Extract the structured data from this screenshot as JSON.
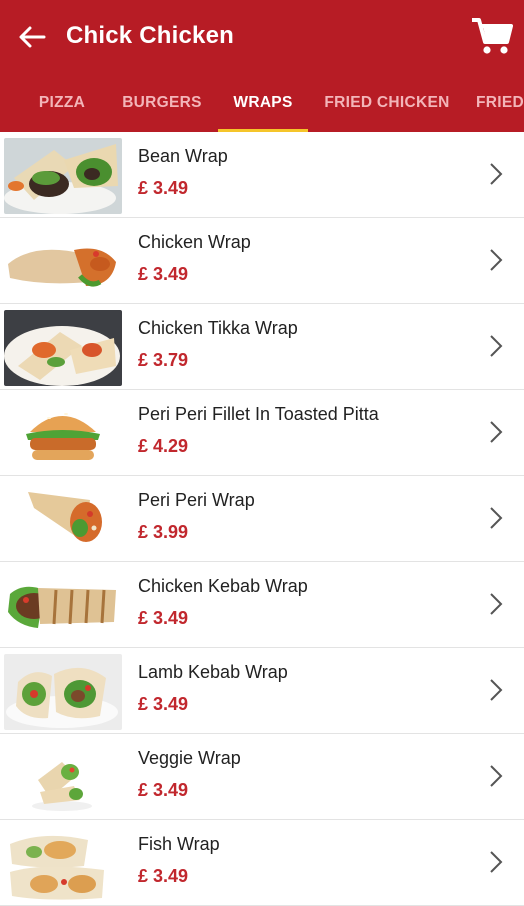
{
  "header": {
    "title": "Chick Chicken",
    "back_icon": "arrow-left-icon",
    "cart_icon": "shopping-cart-icon"
  },
  "tabs": [
    {
      "label": "PIZZA"
    },
    {
      "label": "BURGERS"
    },
    {
      "label": "WRAPS",
      "active": true
    },
    {
      "label": "FRIED CHICKEN"
    },
    {
      "label": "FRIED"
    }
  ],
  "items": [
    {
      "name": "Bean Wrap",
      "price": "£ 3.49"
    },
    {
      "name": "Chicken Wrap",
      "price": "£ 3.49"
    },
    {
      "name": "Chicken Tikka Wrap",
      "price": "£ 3.79"
    },
    {
      "name": "Peri Peri Fillet In Toasted Pitta",
      "price": "£ 4.29"
    },
    {
      "name": "Peri Peri Wrap",
      "price": "£ 3.99"
    },
    {
      "name": "Chicken Kebab Wrap",
      "price": "£ 3.49"
    },
    {
      "name": "Lamb Kebab Wrap",
      "price": "£ 3.49"
    },
    {
      "name": "Veggie Wrap",
      "price": "£ 3.49"
    },
    {
      "name": "Fish Wrap",
      "price": "£ 3.49"
    }
  ],
  "colors": {
    "primary": "#b71c25",
    "price": "#c1272d",
    "tab_indicator": "#f5c52a",
    "tab_inactive": "#f3b5b9"
  }
}
